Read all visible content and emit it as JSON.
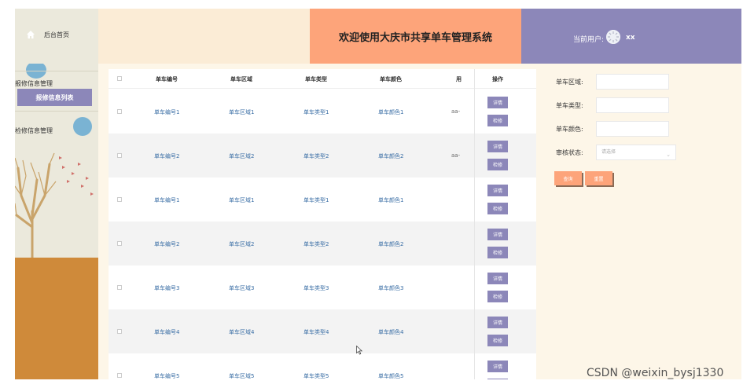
{
  "header": {
    "home_label": "后台首页",
    "title": "欢迎使用大庆市共享单车管理系统",
    "user_label": "当前用户:",
    "user_name": "xx"
  },
  "sidebar": {
    "groups": [
      {
        "label": "报修信息管理",
        "sub": "报修信息列表"
      },
      {
        "label": "检修信息管理"
      }
    ]
  },
  "table": {
    "headers": [
      "单车编号",
      "单车区域",
      "单车类型",
      "单车颜色",
      "用",
      "操作"
    ],
    "rows": [
      {
        "no": "单车编号1",
        "area": "单车区域1",
        "type": "单车类型1",
        "color": "单车颜色1",
        "extra": "aa-"
      },
      {
        "no": "单车编号2",
        "area": "单车区域2",
        "type": "单车类型2",
        "color": "单车颜色2",
        "extra": "aa-"
      },
      {
        "no": "单车编号1",
        "area": "单车区域1",
        "type": "单车类型1",
        "color": "单车颜色1",
        "extra": ""
      },
      {
        "no": "单车编号2",
        "area": "单车区域2",
        "type": "单车类型2",
        "color": "单车颜色2",
        "extra": ""
      },
      {
        "no": "单车编号3",
        "area": "单车区域3",
        "type": "单车类型3",
        "color": "单车颜色3",
        "extra": ""
      },
      {
        "no": "单车编号4",
        "area": "单车区域4",
        "type": "单车类型4",
        "color": "单车颜色4",
        "extra": ""
      },
      {
        "no": "单车编号5",
        "area": "单车区域5",
        "type": "单车类型5",
        "color": "单车颜色5",
        "extra": ""
      }
    ],
    "detail_label": "详情",
    "repair_label": "检修"
  },
  "filter": {
    "area_label": "单车区域:",
    "type_label": "单车类型:",
    "color_label": "单车颜色:",
    "status_label": "审核状态:",
    "status_placeholder": "请选择",
    "query_label": "查询",
    "reset_label": "重置"
  },
  "colors": {
    "accent_purple": "#8c87b9",
    "accent_orange": "#fda47a",
    "sidebar_bg": "#ebe9dc",
    "ground": "#cf8a3a"
  },
  "watermark": "CSDN @weixin_bysj1330"
}
